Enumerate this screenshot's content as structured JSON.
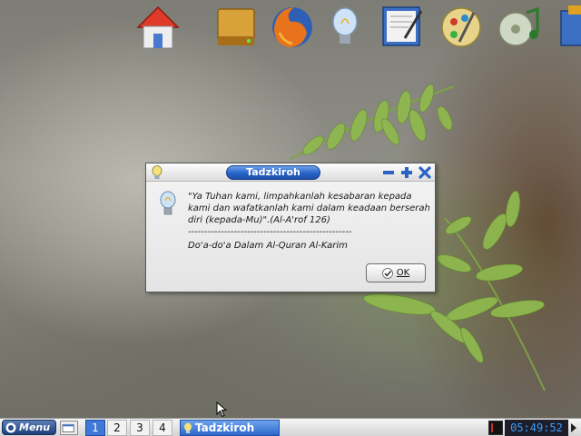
{
  "desktop": {
    "icons": [
      {
        "name": "home-icon"
      },
      {
        "name": "drive-icon"
      },
      {
        "name": "firefox-icon"
      },
      {
        "name": "tips-icon"
      },
      {
        "name": "text-editor-icon"
      },
      {
        "name": "graphics-icon"
      },
      {
        "name": "music-icon"
      },
      {
        "name": "partial-app-icon"
      }
    ]
  },
  "dialog": {
    "title": "Tadzkiroh",
    "message": "\"Ya Tuhan kami, limpahkanlah kesabaran kepada kami dan wafatkanlah kami dalam keadaan berserah diri (kepada-Mu)\".(Al-A'rof 126)",
    "separator": "--------------------------------------------------",
    "source": "Do'a-do'a Dalam Al-Quran Al-Karim",
    "ok_label": "OK"
  },
  "taskbar": {
    "menu_label": "Menu",
    "workspaces": [
      "1",
      "2",
      "3",
      "4"
    ],
    "active_workspace": "1",
    "task_label": "Tadzkiroh",
    "clock": "05:49:52"
  },
  "colors": {
    "title_blue": "#2863c8",
    "clock_text": "#3a9cff",
    "clock_bg": "#1e1e2a"
  }
}
